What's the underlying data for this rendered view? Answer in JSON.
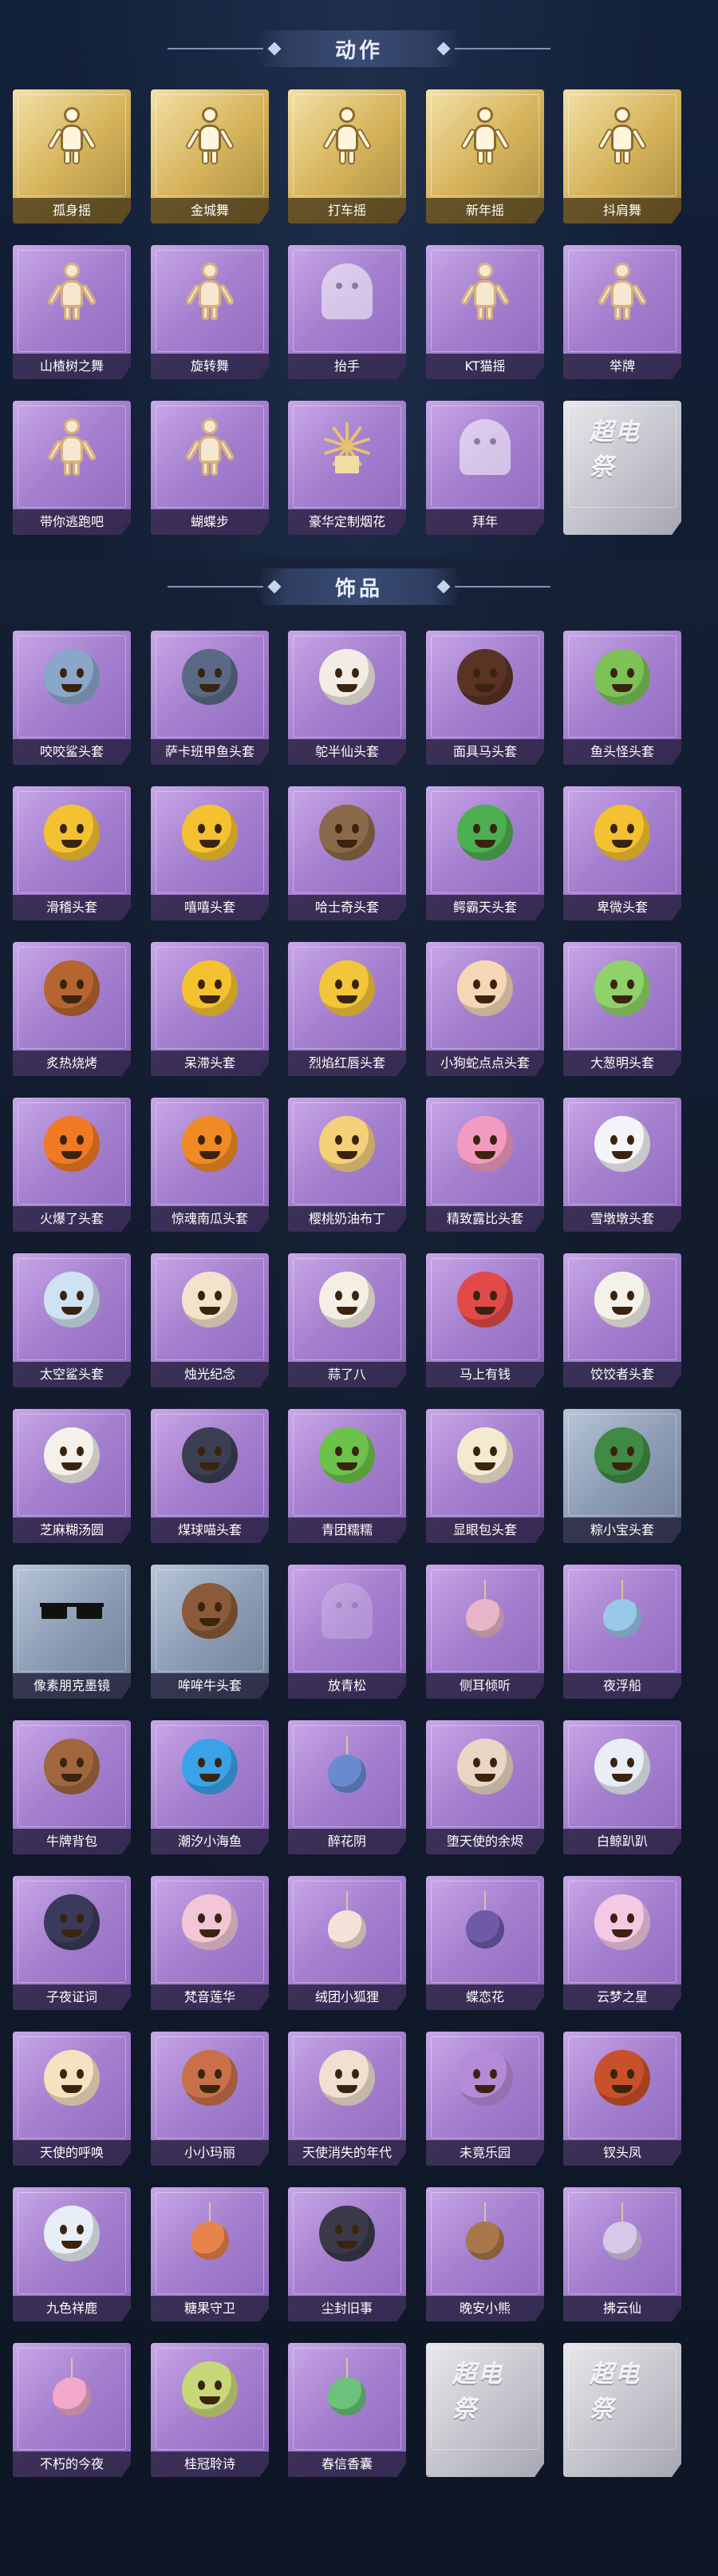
{
  "sections": {
    "actions": {
      "title": "动作",
      "cards": [
        {
          "label": "孤身摇",
          "style": "gold",
          "icon": "dancing-figure-icon"
        },
        {
          "label": "金城舞",
          "style": "gold",
          "icon": "dancing-figure-icon"
        },
        {
          "label": "打车摇",
          "style": "gold",
          "icon": "dancing-figure-icon"
        },
        {
          "label": "新年摇",
          "style": "gold",
          "icon": "dancing-figure-icon"
        },
        {
          "label": "抖肩舞",
          "style": "gold",
          "icon": "dancing-figure-icon"
        },
        {
          "label": "山楂树之舞",
          "style": "purple",
          "icon": "dancing-figure-icon"
        },
        {
          "label": "旋转舞",
          "style": "purple",
          "icon": "dancing-figure-icon"
        },
        {
          "label": "抬手",
          "style": "purple",
          "icon": "ghost-figure-icon"
        },
        {
          "label": "KT猫摇",
          "style": "purple",
          "icon": "dancing-figure-icon"
        },
        {
          "label": "举牌",
          "style": "purple",
          "icon": "sign-holder-icon"
        },
        {
          "label": "带你逃跑吧",
          "style": "purple",
          "icon": "dancing-figure-icon"
        },
        {
          "label": "蝴蝶步",
          "style": "purple",
          "icon": "dancing-figure-icon"
        },
        {
          "label": "豪华定制烟花",
          "style": "purple",
          "icon": "fireworks-icon"
        },
        {
          "label": "拜年",
          "style": "purple",
          "icon": "ghost-figure-icon"
        },
        {
          "label": "",
          "style": "silver",
          "icon": "placeholder-logo-icon",
          "stamp": "超电祭"
        }
      ]
    },
    "items": {
      "title": "饰品",
      "cards": [
        {
          "label": "咬咬鲨头套",
          "style": "purple",
          "icon": "shark-head-icon",
          "color": "#8aa6c8"
        },
        {
          "label": "萨卡班甲鱼头套",
          "style": "purple",
          "icon": "fish-head-icon",
          "color": "#5a6a84"
        },
        {
          "label": "鸵半仙头套",
          "style": "purple",
          "icon": "panda-head-icon",
          "color": "#f2ece4"
        },
        {
          "label": "面具马头套",
          "style": "purple",
          "icon": "horse-head-icon",
          "color": "#5a3324"
        },
        {
          "label": "鱼头怪头套",
          "style": "purple",
          "icon": "green-fish-head-icon",
          "color": "#7cc257"
        },
        {
          "label": "滑稽头套",
          "style": "purple",
          "icon": "emoji-face-icon",
          "color": "#f4c230"
        },
        {
          "label": "嘻嘻头套",
          "style": "purple",
          "icon": "emoji-face-icon",
          "color": "#f4c230"
        },
        {
          "label": "哈士奇头套",
          "style": "purple",
          "icon": "husky-head-icon",
          "color": "#8a6a4a"
        },
        {
          "label": "鳄霸天头套",
          "style": "purple",
          "icon": "crocodile-head-icon",
          "color": "#4caf50"
        },
        {
          "label": "卑微头套",
          "style": "purple",
          "icon": "emoji-face-icon",
          "color": "#f4c230"
        },
        {
          "label": "炙热烧烤",
          "style": "purple",
          "icon": "bbq-icon",
          "color": "#b5652f"
        },
        {
          "label": "呆滞头套",
          "style": "purple",
          "icon": "emoji-face-icon",
          "color": "#f4c230"
        },
        {
          "label": "烈焰红唇头套",
          "style": "purple",
          "icon": "pikachu-head-icon",
          "color": "#f2c53a"
        },
        {
          "label": "小狗蛇点点头套",
          "style": "purple",
          "icon": "cream-head-icon",
          "color": "#f5d7b6"
        },
        {
          "label": "大葱明头套",
          "style": "purple",
          "icon": "leek-head-icon",
          "color": "#8fd26a"
        },
        {
          "label": "火爆了头套",
          "style": "purple",
          "icon": "fire-head-icon",
          "color": "#f07a24"
        },
        {
          "label": "惊魂南瓜头套",
          "style": "purple",
          "icon": "pumpkin-head-icon",
          "color": "#f08a24"
        },
        {
          "label": "樱桃奶油布丁",
          "style": "purple",
          "icon": "pudding-icon",
          "color": "#f5cf7a"
        },
        {
          "label": "精致露比头套",
          "style": "purple",
          "icon": "pink-pig-head-icon",
          "color": "#f29ac0"
        },
        {
          "label": "雪墩墩头套",
          "style": "purple",
          "icon": "snowman-head-icon",
          "color": "#f4f4f8"
        },
        {
          "label": "太空鲨头套",
          "style": "purple",
          "icon": "space-shark-icon",
          "color": "#cfe2f2"
        },
        {
          "label": "烛光纪念",
          "style": "purple",
          "icon": "candle-icon",
          "color": "#f4e3cc"
        },
        {
          "label": "蒜了八",
          "style": "purple",
          "icon": "garlic-head-icon",
          "color": "#f4efe2"
        },
        {
          "label": "马上有钱",
          "style": "purple",
          "icon": "horse-toy-icon",
          "color": "#e24a4a"
        },
        {
          "label": "饺饺者头套",
          "style": "purple",
          "icon": "dumpling-head-icon",
          "color": "#f4f1ea"
        },
        {
          "label": "芝麻糊汤圆",
          "style": "purple",
          "icon": "tangyuan-head-icon",
          "color": "#f4f1ea"
        },
        {
          "label": "煤球喵头套",
          "style": "purple",
          "icon": "black-cat-head-icon",
          "color": "#3b3f52"
        },
        {
          "label": "青团糯糯",
          "style": "purple",
          "icon": "qingtuan-head-icon",
          "color": "#6cc24a"
        },
        {
          "label": "显眼包头套",
          "style": "purple",
          "icon": "bun-head-icon",
          "color": "#f4ead2"
        },
        {
          "label": "粽小宝头套",
          "style": "blue",
          "icon": "zongzi-head-icon",
          "color": "#3f8a44"
        },
        {
          "label": "像素朋克墨镜",
          "style": "blue",
          "icon": "pixel-sunglasses-icon",
          "color": "#111111"
        },
        {
          "label": "哞哞牛头套",
          "style": "blue",
          "icon": "cow-head-icon",
          "color": "#8a5a3a"
        },
        {
          "label": "放青松",
          "style": "purple",
          "icon": "empty-slot-icon",
          "color": ""
        },
        {
          "label": "侧耳倾听",
          "style": "purple",
          "icon": "flower-earring-icon",
          "color": "#e7b4c8"
        },
        {
          "label": "夜浮船",
          "style": "purple",
          "icon": "crystal-ornament-icon",
          "color": "#9ac8e8"
        },
        {
          "label": "牛牌背包",
          "style": "purple",
          "icon": "cow-backpack-icon",
          "color": "#a0673f"
        },
        {
          "label": "潮汐小海鱼",
          "style": "purple",
          "icon": "blue-fish-icon",
          "color": "#3aa2e8"
        },
        {
          "label": "醉花阴",
          "style": "purple",
          "icon": "lantern-pendant-icon",
          "color": "#6a8ad0"
        },
        {
          "label": "堕天使的余烬",
          "style": "purple",
          "icon": "doll-icon",
          "color": "#e9d6c4"
        },
        {
          "label": "白鲸趴趴",
          "style": "purple",
          "icon": "beluga-icon",
          "color": "#e9eef6"
        },
        {
          "label": "子夜证词",
          "style": "purple",
          "icon": "dark-angel-icon",
          "color": "#3a3a5a"
        },
        {
          "label": "梵音莲华",
          "style": "purple",
          "icon": "lotus-doll-icon",
          "color": "#f2c6d6"
        },
        {
          "label": "绒团小狐狸",
          "style": "purple",
          "icon": "fox-pendant-icon",
          "color": "#f2e2d8"
        },
        {
          "label": "蝶恋花",
          "style": "purple",
          "icon": "butterfly-pendant-icon",
          "color": "#6f5aa8"
        },
        {
          "label": "云梦之星",
          "style": "purple",
          "icon": "unicorn-icon",
          "color": "#f5c8e4"
        },
        {
          "label": "天使的呼唤",
          "style": "purple",
          "icon": "angel-doll-icon",
          "color": "#f4e2c0"
        },
        {
          "label": "小小玛丽",
          "style": "purple",
          "icon": "girl-doll-icon",
          "color": "#c8704a"
        },
        {
          "label": "天使消失的年代",
          "style": "purple",
          "icon": "angel-doll-icon",
          "color": "#f0e0d0"
        },
        {
          "label": "未竟乐园",
          "style": "purple",
          "icon": "purple-doll-icon",
          "color": "#b58ad8"
        },
        {
          "label": "钗头凤",
          "style": "purple",
          "icon": "headdress-icon",
          "color": "#c8502a"
        },
        {
          "label": "九色祥鹿",
          "style": "purple",
          "icon": "deer-icon",
          "color": "#e8eef6"
        },
        {
          "label": "糖果守卫",
          "style": "purple",
          "icon": "candy-pendant-icon",
          "color": "#e8844a"
        },
        {
          "label": "尘封旧事",
          "style": "purple",
          "icon": "boy-doll-icon",
          "color": "#3a3a4a"
        },
        {
          "label": "晚安小熊",
          "style": "purple",
          "icon": "bear-pendant-icon",
          "color": "#a8784a"
        },
        {
          "label": "拂云仙",
          "style": "purple",
          "icon": "fairy-pendant-icon",
          "color": "#d8c8e8"
        },
        {
          "label": "不朽的今夜",
          "style": "purple",
          "icon": "pink-pendant-icon",
          "color": "#f2a8c8"
        },
        {
          "label": "桂冠聆诗",
          "style": "purple",
          "icon": "laurel-doll-icon",
          "color": "#c8d878"
        },
        {
          "label": "春信香囊",
          "style": "purple",
          "icon": "sachet-icon",
          "color": "#6cc27a"
        },
        {
          "label": "",
          "style": "silver",
          "icon": "placeholder-logo-icon",
          "stamp": "超电祭"
        },
        {
          "label": "",
          "style": "silver",
          "icon": "placeholder-logo-icon",
          "stamp": "超电祭"
        }
      ]
    }
  }
}
